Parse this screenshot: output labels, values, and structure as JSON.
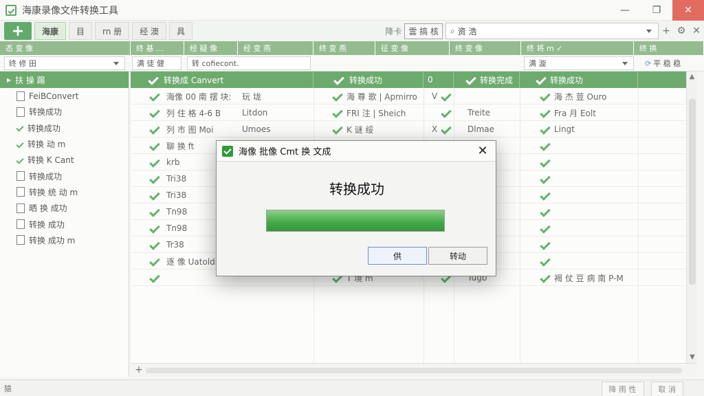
{
  "window": {
    "title": "海康录像文件转换工具",
    "min": "—",
    "max": "❐",
    "close": "✕"
  },
  "toolbar": {
    "add": "+",
    "tabs": [
      "海康",
      "目",
      "rn 册",
      "经 澳",
      "具"
    ],
    "sort_label": "降卡",
    "sort_tag": "雲 搞 核",
    "search_value": "资 浩",
    "plus_icon": "+",
    "settings_icon": "⚙",
    "close_icon": "✕"
  },
  "col_headers": [
    "态 变 像",
    "终 基 …",
    "经 疑 像",
    "经 变 燕",
    "终 变 燕",
    "征 变 像",
    "终 变 像",
    "终 将 m ✓",
    "终 换"
  ],
  "filters": {
    "left": "终 修 田",
    "f1": "满 徒 健",
    "f2": "转 cofiecont.",
    "f3": "满 漩",
    "refresh": "平 稳 稳"
  },
  "left_panel": {
    "header": "扶 操 踢",
    "items": [
      "FeiBConvert",
      "转换成功",
      "转换成功",
      "转换 动 m",
      "转换 K Cant",
      "转换成功",
      "转换 统 动 m",
      "晒 换 成功",
      "转换 成功",
      "转换 成功 m"
    ]
  },
  "grid_head": {
    "c1": "转换成 Canvert",
    "c2": "转换成功",
    "c3": "0",
    "c4": "转换完成",
    "c5": "转换成功"
  },
  "rows": [
    {
      "a": "海像 00 南 摆 块:",
      "b": "玩 垅",
      "c": "海 尊 歌 | Apmirro",
      "d": "V",
      "e": "",
      "f": "海 杰 荳 Ouro"
    },
    {
      "a": "列 住 格 4-6 B",
      "b": "Litdon",
      "c": "FRI 注 | Sheich",
      "d": "",
      "e": "Treite",
      "f": "Fra 月 Eolt"
    },
    {
      "a": "列 市 图 Moi",
      "b": "Umoes",
      "c": "K 谜 绥",
      "d": "X",
      "e": "Dlmae",
      "f": "Lingt"
    },
    {
      "a": "聊 换 ft",
      "b": "",
      "c": "",
      "d": "",
      "e": "",
      "f": ""
    },
    {
      "a": "krb",
      "b": "",
      "c": "",
      "d": "",
      "e": "",
      "f": ""
    },
    {
      "a": "Tri38",
      "b": "",
      "c": "",
      "d": "",
      "e": "",
      "f": ""
    },
    {
      "a": "Tri38",
      "b": "",
      "c": "",
      "d": "",
      "e": "",
      "f": ""
    },
    {
      "a": "Tn98",
      "b": "",
      "c": "",
      "d": "",
      "e": "",
      "f": ""
    },
    {
      "a": "Tn98",
      "b": "",
      "c": "",
      "d": "",
      "e": "",
      "f": ""
    },
    {
      "a": "Tr38",
      "b": "",
      "c": "",
      "d": "",
      "e": "",
      "f": ""
    },
    {
      "a": "逐 像 Uatoldro",
      "b": "",
      "c": "",
      "d": "",
      "e": "Trek",
      "f": ""
    },
    {
      "a": "",
      "b": "",
      "c": "T 境 m",
      "d": "",
      "e": "Tugb",
      "f": "褐 仗 豆 病 南 P-M"
    }
  ],
  "status": {
    "left": "猿",
    "right1": "降 雨 性",
    "right2": "取 消"
  },
  "dialog": {
    "title": "海像 批像 Cmt 换 文成",
    "message": "转换成功",
    "progress": 1.0,
    "ok": "供",
    "cancel": "转动",
    "close": "✕"
  }
}
